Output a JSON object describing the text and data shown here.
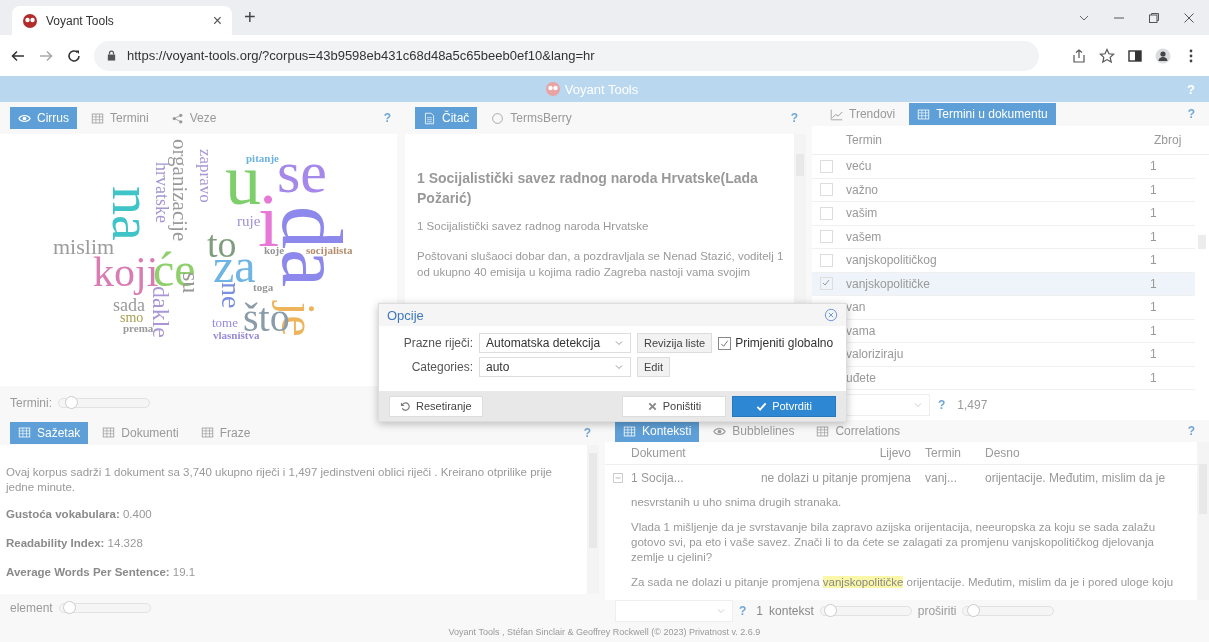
{
  "browser": {
    "tab_title": "Voyant Tools",
    "tab_close": "×",
    "new_tab": "+",
    "url": "https://voyant-tools.org/?corpus=43b9598eb431c68d48a5c65beeb0ef10&lang=hr"
  },
  "app_header": {
    "title": "Voyant Tools",
    "help": "?"
  },
  "cirrus": {
    "tabs": [
      {
        "label": "Cirrus",
        "selected": true
      },
      {
        "label": "Termini",
        "selected": false
      },
      {
        "label": "Veze",
        "selected": false
      }
    ],
    "help": "?",
    "words": [
      {
        "text": "u",
        "color": "#7fce6c"
      },
      {
        "text": "se",
        "color": "#a688ea"
      },
      {
        "text": "i",
        "color": "#e878d8"
      },
      {
        "text": "da",
        "color": "#8d89ec"
      },
      {
        "text": "je",
        "color": "#eeb45c"
      },
      {
        "text": "na",
        "color": "#3fc4c8"
      },
      {
        "text": "koji",
        "color": "#d97cb4"
      },
      {
        "text": "će",
        "color": "#8fcf6c"
      },
      {
        "text": "to",
        "color": "#7f9e7e"
      },
      {
        "text": "za",
        "color": "#6fb5e4"
      },
      {
        "text": "što",
        "color": "#8a9caa"
      },
      {
        "text": "ne",
        "color": "#7d90e0"
      },
      {
        "text": "su",
        "color": "#999999"
      },
      {
        "text": "dakle",
        "color": "#a996d6"
      },
      {
        "text": "organizacije",
        "color": "#9a9a9a"
      },
      {
        "text": "hrvatske",
        "color": "#a595d2"
      },
      {
        "text": "zapravo",
        "color": "#a898d6"
      },
      {
        "text": "mislim",
        "color": "#9c9c9c"
      },
      {
        "text": "sada",
        "color": "#9a9a9a"
      },
      {
        "text": "smo",
        "color": "#a89e50"
      },
      {
        "text": "tome",
        "color": "#9a8ade"
      },
      {
        "text": "pitanje",
        "color": "#6eb2e0"
      },
      {
        "text": "ruje",
        "color": "#a08ed8"
      },
      {
        "text": "koje",
        "color": "#969696"
      },
      {
        "text": "socijalista",
        "color": "#b48c6c"
      },
      {
        "text": "toga",
        "color": "#979797"
      },
      {
        "text": "vlasništva",
        "color": "#988ad8"
      },
      {
        "text": "prema",
        "color": "#9a9a9a"
      }
    ],
    "slider_label": "Termini:",
    "level": 0.08
  },
  "reader": {
    "tabs": [
      {
        "label": "Čitač",
        "selected": true
      },
      {
        "label": "TermsBerry",
        "selected": false
      }
    ],
    "help": "?",
    "heading": "1 Socijalistički savez radnog naroda Hrvatske(Lada Požarić)",
    "subtitle": "1 Socijalistički savez radnog naroda Hrvatske",
    "paragraph": "Poštovani slušaoci dobar dan, a pozdravljala se Nenad Stazić, voditelj 1 od ukupno 40 emisija u kojima radio Zagreba nastoji vama svojim"
  },
  "terms": {
    "tabs": [
      {
        "label": "Trendovi",
        "selected": false
      },
      {
        "label": "Termini u dokumentu",
        "selected": true
      }
    ],
    "help": "?",
    "columns": [
      "Termin",
      "Zbroj"
    ],
    "rows": [
      {
        "term": "veću",
        "count": "1",
        "checked": false,
        "selected": false
      },
      {
        "term": "važno",
        "count": "1",
        "checked": false,
        "selected": false
      },
      {
        "term": "vašim",
        "count": "1",
        "checked": false,
        "selected": false
      },
      {
        "term": "vašem",
        "count": "1",
        "checked": false,
        "selected": false
      },
      {
        "term": "vanjskopolitičkog",
        "count": "1",
        "checked": false,
        "selected": false
      },
      {
        "term": "vanjskopolitičke",
        "count": "1",
        "checked": true,
        "selected": true
      },
      {
        "term": "van",
        "count": "1",
        "selected": false
      },
      {
        "term": "vama",
        "count": "1",
        "selected": false
      },
      {
        "term": "valoriziraju",
        "count": "1",
        "selected": false
      },
      {
        "term": "uđete",
        "count": "1",
        "selected": false
      }
    ],
    "footer_help": "?",
    "total": "1,497"
  },
  "summary": {
    "tabs": [
      {
        "label": "Sažetak",
        "selected": true
      },
      {
        "label": "Dokumenti",
        "selected": false
      },
      {
        "label": "Fraze",
        "selected": false
      }
    ],
    "help": "?",
    "text": "Ovaj korpus sadrži 1 dokument sa 3,740 ukupno riječi i 1,497 jedinstveni oblici riječi . Kreirano otprilike prije jedne minute.",
    "stats": [
      "**Gustoća vokabulara:** 0.400",
      "**Readability Index:** 14.328",
      "**Average Words Per Sentence:** 19.1"
    ],
    "slider_label": "element",
    "level": 0.05
  },
  "contexts": {
    "tabs": [
      {
        "label": "Konteksti",
        "selected": true
      },
      {
        "label": "Bubblelines",
        "selected": false
      },
      {
        "label": "Correlations",
        "selected": false
      }
    ],
    "help": "?",
    "columns": [
      "Dokument",
      "Lijevo",
      "Termin",
      "Desno"
    ],
    "row": {
      "expanded": true,
      "document": "1 Socija...",
      "left": "ne dolazi u pitanje promjena",
      "term": "vanj...",
      "right": "orijentacije. Međutim, mislim da je"
    },
    "expanded_lines": [
      "nesvrstanih u uho snima drugih stranaka.",
      "Vlada 1 mišljenje da je svrstavanje bila zapravo azijska orijentacija, neeuropska za koju se sada zalažu gotovo svi, pa eto i vaše savez. Znači li to da ćete se zalagati za promjenu vanjskopolitičkog djelovanja zemlje u cjelini?"
    ],
    "highlight_line": {
      "before": "Za sada ne dolazi u pitanje promjena ",
      "highlight": "vanjskopolitičke",
      "after": " orijentacije. Međutim, mislim da je i pored uloge koju"
    },
    "footer_help": "?",
    "count": "1",
    "count_label": "kontekst",
    "context_slider": {
      "level": 0.05
    },
    "expand_label": "proširiti",
    "expand_slider": {
      "level": 0.05
    }
  },
  "footer": "Voyant Tools , Stéfan Sinclair & Geoffrey Rockwell (© 2023) Privatnost v. 2.6.9",
  "dialog": {
    "title": "Opcije",
    "fields": [
      {
        "label": "Prazne riječi:",
        "value": "Automatska detekcija",
        "button": "Revizija liste"
      },
      {
        "label": "Categories:",
        "value": "auto",
        "button": "Edit"
      }
    ],
    "checkbox": {
      "label": "Primjeniti globalno",
      "checked": true
    },
    "buttons": [
      {
        "label": "Resetiranje",
        "kind": "reset"
      },
      {
        "label": "Poništiti",
        "kind": "cancel"
      },
      {
        "label": "Potvrditi",
        "kind": "confirm"
      }
    ]
  }
}
